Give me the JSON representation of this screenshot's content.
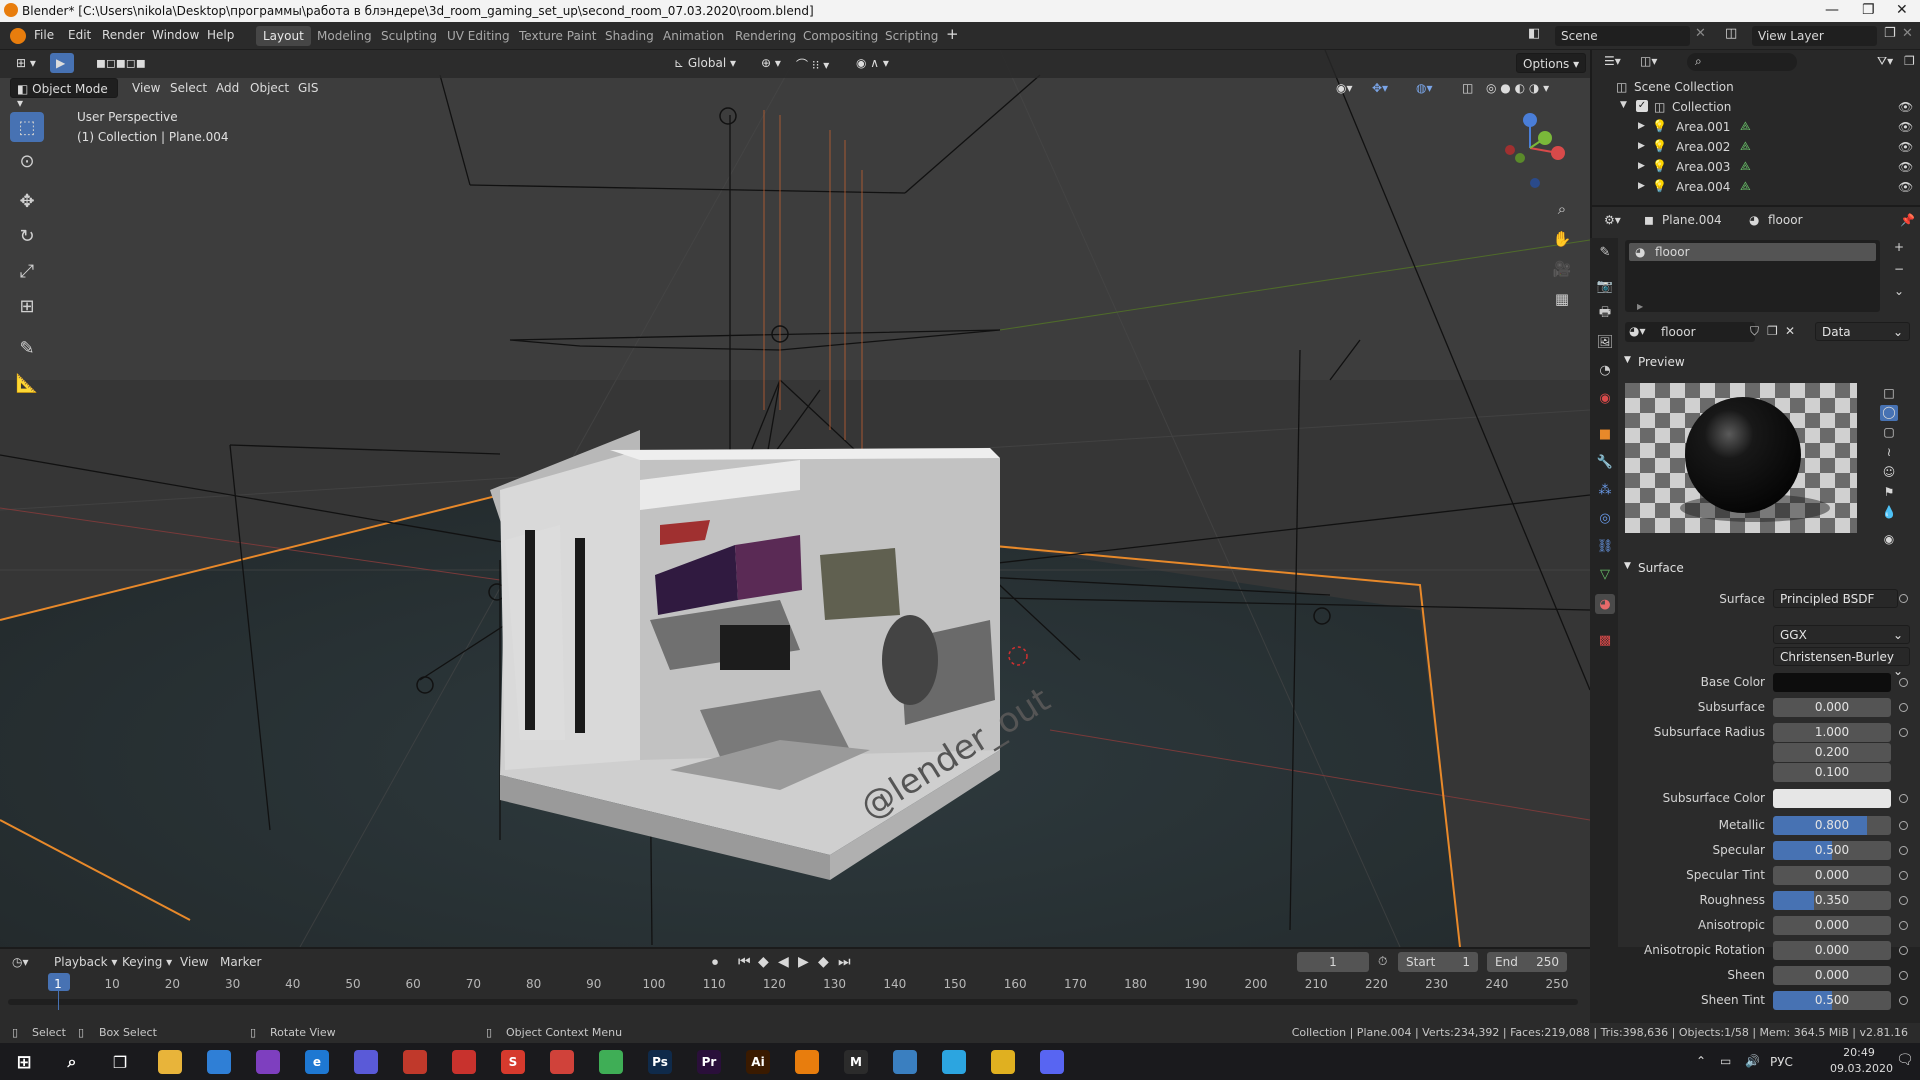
{
  "window": {
    "title": "Blender* [C:\\Users\\nikola\\Desktop\\программы\\работа в блэндере\\3d_room_gaming_set_up\\second_room_07.03.2020\\room.blend]"
  },
  "menu": [
    "File",
    "Edit",
    "Render",
    "Window",
    "Help"
  ],
  "workspaces": [
    "Layout",
    "Modeling",
    "Sculpting",
    "UV Editing",
    "Texture Paint",
    "Shading",
    "Animation",
    "Rendering",
    "Compositing",
    "Scripting"
  ],
  "scene": {
    "name": "Scene",
    "view_layer": "View Layer"
  },
  "viewport": {
    "header": {
      "transform": "Global",
      "options": "Options"
    },
    "mode": "Object Mode",
    "menus": [
      "View",
      "Select",
      "Add",
      "Object",
      "GIS"
    ],
    "overlay_title": "User Perspective",
    "overlay_sub": "(1) Collection | Plane.004",
    "watermark": "@lender_out"
  },
  "outliner": {
    "root": "Scene Collection",
    "collection": "Collection",
    "items": [
      "Area.001",
      "Area.002",
      "Area.003",
      "Area.004"
    ]
  },
  "properties": {
    "object": "Plane.004",
    "material": "flooor",
    "slot": "flooor",
    "data_link": "Data",
    "preview_label": "Preview",
    "surface_label": "Surface",
    "surface_shader_label": "Surface",
    "surface_shader": "Principled BSDF",
    "distribution": "GGX",
    "subsurface_method": "Christensen-Burley",
    "base_color_label": "Base Color",
    "base_color": "#0d0d0d",
    "subsurface_color_label": "Subsurface Color",
    "subsurface_color": "#e6e6e6",
    "subsurface_radius_label": "Subsurface Radius",
    "subsurface_radius": [
      "1.000",
      "0.200",
      "0.100"
    ],
    "fields": [
      {
        "label": "Subsurface",
        "value": "0.000",
        "fill": 0
      },
      {
        "label": "Metallic",
        "value": "0.800",
        "fill": 0.8
      },
      {
        "label": "Specular",
        "value": "0.500",
        "fill": 0.5
      },
      {
        "label": "Specular Tint",
        "value": "0.000",
        "fill": 0
      },
      {
        "label": "Roughness",
        "value": "0.350",
        "fill": 0.35
      },
      {
        "label": "Anisotropic",
        "value": "0.000",
        "fill": 0
      },
      {
        "label": "Anisotropic Rotation",
        "value": "0.000",
        "fill": 0
      },
      {
        "label": "Sheen",
        "value": "0.000",
        "fill": 0
      },
      {
        "label": "Sheen Tint",
        "value": "0.500",
        "fill": 0.5
      }
    ]
  },
  "timeline": {
    "menus": [
      "Playback",
      "Keying",
      "View",
      "Marker"
    ],
    "current_frame": "1",
    "start_label": "Start",
    "start": "1",
    "end_label": "End",
    "end": "250",
    "ticks": [
      "1",
      "10",
      "20",
      "30",
      "40",
      "50",
      "60",
      "70",
      "80",
      "90",
      "100",
      "110",
      "120",
      "130",
      "140",
      "150",
      "160",
      "170",
      "180",
      "190",
      "200",
      "210",
      "220",
      "230",
      "240",
      "250"
    ]
  },
  "status": {
    "select": "Select",
    "box_select": "Box Select",
    "rotate": "Rotate View",
    "context": "Object Context Menu",
    "stats": "Collection | Plane.004 | Verts:234,392 | Faces:219,088 | Tris:398,636 | Objects:1/58 | Mem: 364.5 MiB | v2.81.16"
  },
  "taskbar": {
    "lang": "РУС",
    "time": "20:49",
    "date": "09.03.2020",
    "apps": [
      {
        "icon": "file-explorer-icon",
        "glyph": "",
        "color": "#e8b43a"
      },
      {
        "icon": "mail-icon",
        "glyph": "",
        "color": "#2f7fd6"
      },
      {
        "icon": "tor-browser-icon",
        "glyph": "",
        "color": "#7e3fbf"
      },
      {
        "icon": "edge-icon",
        "glyph": "e",
        "color": "#1e78d2"
      },
      {
        "icon": "game-app-icon",
        "glyph": "",
        "color": "#5a5ad8"
      },
      {
        "icon": "red-app-icon",
        "glyph": "",
        "color": "#c0392b"
      },
      {
        "icon": "solidworks-icon",
        "glyph": "",
        "color": "#c8322d"
      },
      {
        "icon": "sketchup-icon",
        "glyph": "S",
        "color": "#d63a2d"
      },
      {
        "icon": "red-circle-app-icon",
        "glyph": "",
        "color": "#d0423a"
      },
      {
        "icon": "green-app-icon",
        "glyph": "",
        "color": "#3fae56"
      },
      {
        "icon": "photoshop-icon",
        "glyph": "Ps",
        "color": "#0f2a4a"
      },
      {
        "icon": "premiere-icon",
        "glyph": "Pr",
        "color": "#2a0f3a"
      },
      {
        "icon": "illustrator-icon",
        "glyph": "Ai",
        "color": "#3a1a00"
      },
      {
        "icon": "blender-icon",
        "glyph": "",
        "color": "#e87d0d"
      },
      {
        "icon": "m-app-icon",
        "glyph": "M",
        "color": "#2b2b2b"
      },
      {
        "icon": "remote-app-icon",
        "glyph": "",
        "color": "#3a7fc0"
      },
      {
        "icon": "telegram-icon",
        "glyph": "",
        "color": "#2ca5e0"
      },
      {
        "icon": "chrome-icon",
        "glyph": "",
        "color": "#e0b020"
      },
      {
        "icon": "discord-icon",
        "glyph": "",
        "color": "#5865f2"
      }
    ]
  }
}
